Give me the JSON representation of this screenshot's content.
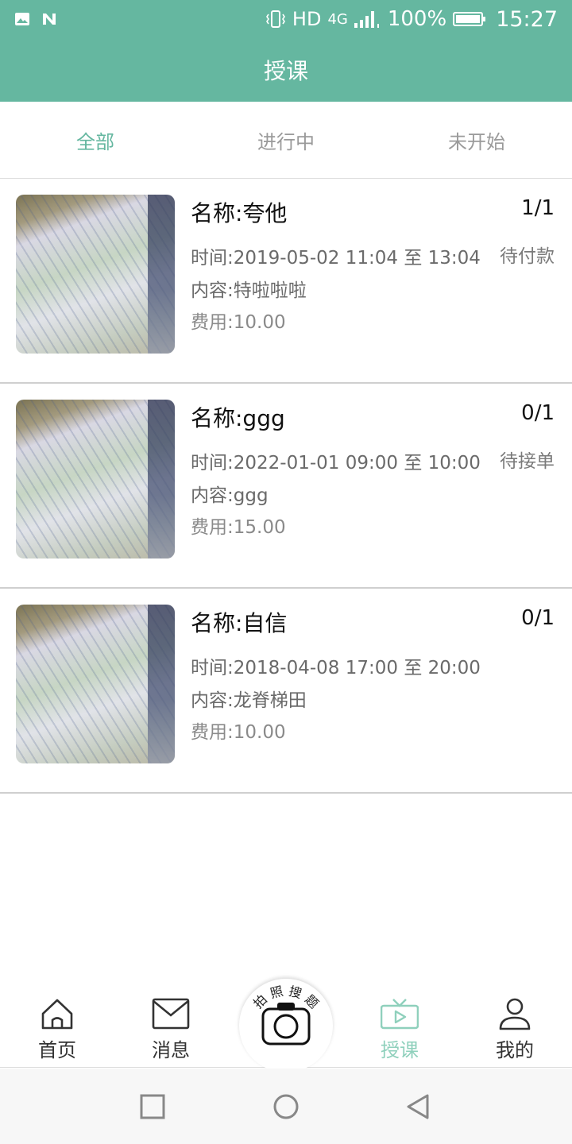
{
  "status_bar": {
    "network": "HD",
    "signal_type": "4G",
    "battery": "100%",
    "time": "15:27",
    "icons": [
      "image-icon",
      "nfc-icon",
      "vibrate-icon",
      "signal-icon",
      "battery-icon"
    ]
  },
  "app_bar": {
    "title": "授课"
  },
  "tabs": [
    {
      "label": "全部",
      "active": true
    },
    {
      "label": "进行中",
      "active": false
    },
    {
      "label": "未开始",
      "active": false
    }
  ],
  "courses": [
    {
      "title": "名称:夸他",
      "count": "1/1",
      "status": "待付款",
      "time": "时间:2019-05-02 11:04 至 13:04",
      "content": "内容:特啦啦啦",
      "fee": "费用:10.00"
    },
    {
      "title": "名称:ggg",
      "count": "0/1",
      "status": "待接单",
      "time": "时间:2022-01-01 09:00 至 10:00",
      "content": "内容:ggg",
      "fee": "费用:15.00"
    },
    {
      "title": "名称:自信",
      "count": "0/1",
      "status": "",
      "time": "时间:2018-04-08 17:00 至 20:00",
      "content": "内容:龙脊梯田",
      "fee": "费用:10.00"
    }
  ],
  "bottom_nav": {
    "home": "首页",
    "messages": "消息",
    "camera_text": "拍 照 搜 题",
    "teach": "授课",
    "me": "我的"
  },
  "colors": {
    "primary": "#65b7a0",
    "active_nav": "#8fd0bc",
    "text_secondary": "#7a7a7a"
  }
}
